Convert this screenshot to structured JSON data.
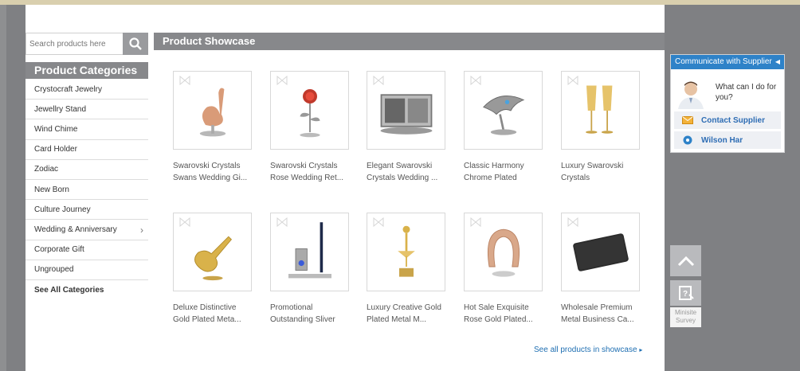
{
  "search": {
    "placeholder": "Search products here",
    "icon": "search-icon"
  },
  "categories": {
    "title": "Product Categories",
    "items": [
      {
        "label": "Crystocraft Jewelry",
        "has_sub": false
      },
      {
        "label": "Jewellry Stand",
        "has_sub": false
      },
      {
        "label": "Wind Chime",
        "has_sub": false
      },
      {
        "label": "Card Holder",
        "has_sub": false
      },
      {
        "label": "Zodiac",
        "has_sub": false
      },
      {
        "label": "New Born",
        "has_sub": false
      },
      {
        "label": "Culture Journey",
        "has_sub": false
      },
      {
        "label": "Wedding & Anniversary",
        "has_sub": true
      },
      {
        "label": "Corporate Gift",
        "has_sub": false
      },
      {
        "label": "Ungrouped",
        "has_sub": false
      }
    ],
    "see_all": "See All Categories"
  },
  "showcase": {
    "title": "Product Showcase",
    "products": [
      {
        "line1": "Swarovski Crystals",
        "line2": "Swans Wedding Gi...",
        "icon": "swan-figurine"
      },
      {
        "line1": "Swarovski Crystals",
        "line2": "Rose Wedding Ret...",
        "icon": "rose-figurine"
      },
      {
        "line1": "Elegant Swarovski",
        "line2": "Crystals Wedding ...",
        "icon": "photo-frame"
      },
      {
        "line1": "Classic Harmony",
        "line2": "Chrome Plated",
        "icon": "dolphin-figurine"
      },
      {
        "line1": "Luxury Swarovski",
        "line2": "Crystals",
        "icon": "champagne-glasses"
      },
      {
        "line1": "Deluxe Distinctive",
        "line2": "Gold Plated Meta...",
        "icon": "violin-figurine"
      },
      {
        "line1": "Promotional",
        "line2": "Outstanding Sliver",
        "icon": "golf-pen-stand"
      },
      {
        "line1": "Luxury Creative Gold",
        "line2": "Plated Metal M...",
        "icon": "ballerina-figurine"
      },
      {
        "line1": "Hot Sale Exquisite",
        "line2": "Rose Gold Plated...",
        "icon": "horseshoe-figurine"
      },
      {
        "line1": "Wholesale Premium",
        "line2": "Metal Business Ca...",
        "icon": "card-case"
      }
    ],
    "see_all": "See all products in showcase"
  },
  "supplier": {
    "header": "Communicate with Supplier",
    "greeting": "What can I do for you?",
    "contact_label": "Contact Supplier",
    "agent_name": "Wilson Har"
  },
  "side_tools": {
    "survey_label": "Minisite Survey"
  },
  "colors": {
    "accent": "#2e82c8",
    "bar": "#87888b",
    "link": "#1f6fb2",
    "page_bg": "#7f8083"
  }
}
